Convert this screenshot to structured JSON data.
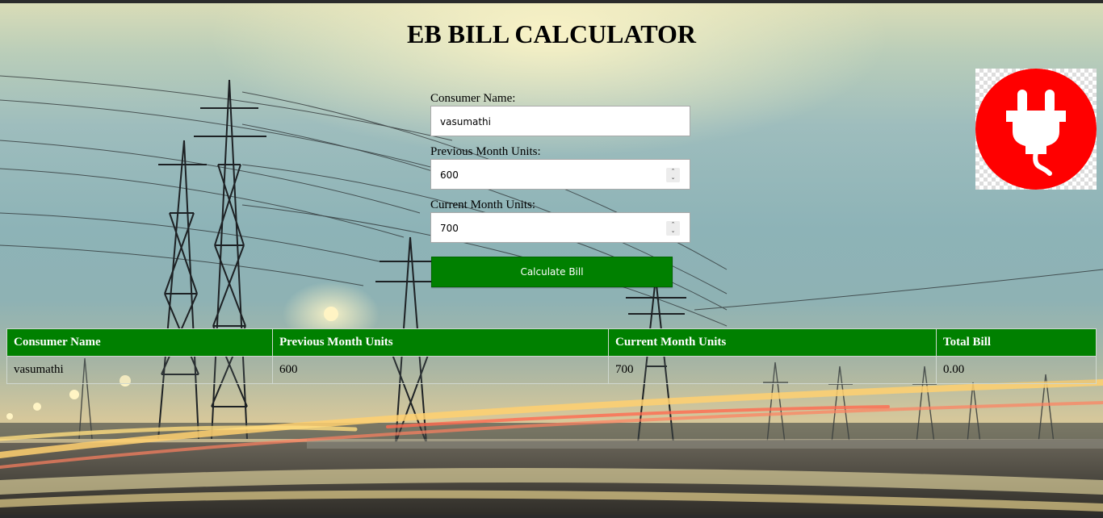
{
  "page": {
    "title": "EB BILL CALCULATOR"
  },
  "form": {
    "consumer_name_label": "Consumer Name:",
    "consumer_name_value": "vasumathi",
    "previous_units_label": "Previous Month Units:",
    "previous_units_value": "600",
    "current_units_label": "Current Month Units:",
    "current_units_value": "700",
    "submit_label": "Calculate Bill"
  },
  "logo": {
    "icon": "power-plug-icon",
    "color": "#ff0000"
  },
  "results_table": {
    "headers": [
      "Consumer Name",
      "Previous Month Units",
      "Current Month Units",
      "Total Bill"
    ],
    "rows": [
      [
        "vasumathi",
        "600",
        "700",
        "0.00"
      ]
    ]
  },
  "colors": {
    "accent": "#008000",
    "button_text": "#ffffff"
  }
}
